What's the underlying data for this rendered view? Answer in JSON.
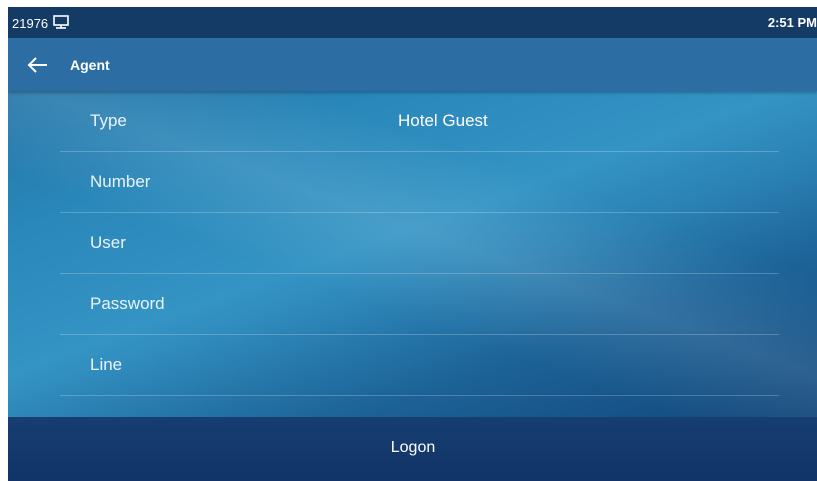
{
  "status_bar": {
    "extension": "21976",
    "network_icon": "network-icon",
    "time": "2:51 PM"
  },
  "header": {
    "back_icon": "back-arrow-icon",
    "title": "Agent"
  },
  "fields": [
    {
      "label": "Type",
      "value": "Hotel Guest"
    },
    {
      "label": "Number",
      "value": ""
    },
    {
      "label": "User",
      "value": ""
    },
    {
      "label": "Password",
      "value": ""
    },
    {
      "label": "Line",
      "value": ""
    }
  ],
  "footer": {
    "logon_label": "Logon"
  },
  "colors": {
    "status_bar": "#143a66",
    "title_bar": "#2c6ea4",
    "bottom_bar": "#123468"
  }
}
